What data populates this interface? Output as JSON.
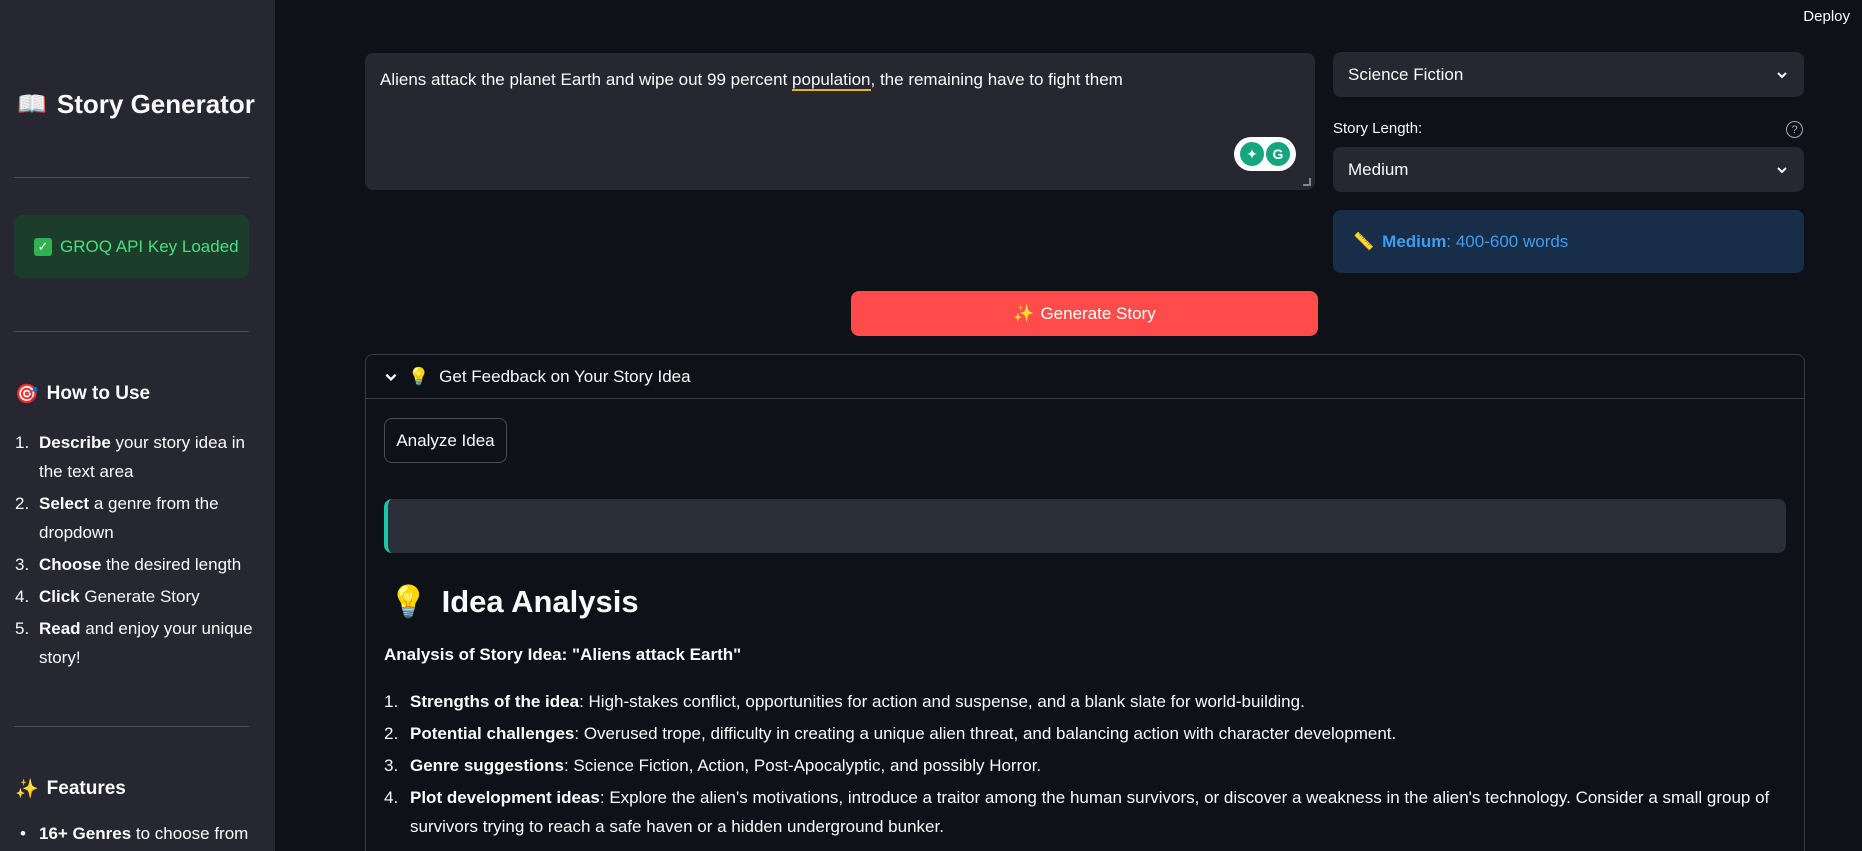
{
  "header": {
    "deploy_label": "Deploy"
  },
  "sidebar": {
    "title": "Story Generator",
    "api_status": "GROQ API Key Loaded",
    "how_to": {
      "heading": "How to Use",
      "steps": [
        {
          "num": "1.",
          "bold": "Describe",
          "text": " your story idea in the text area"
        },
        {
          "num": "2.",
          "bold": "Select",
          "text": " a genre from the dropdown"
        },
        {
          "num": "3.",
          "bold": "Choose",
          "text": " the desired length"
        },
        {
          "num": "4.",
          "bold": "Click",
          "text": " Generate Story"
        },
        {
          "num": "5.",
          "bold": "Read",
          "text": " and enjoy your unique story!"
        }
      ]
    },
    "features": {
      "heading": "Features",
      "items": [
        {
          "bold": "16+ Genres",
          "text": " to choose from"
        }
      ]
    }
  },
  "main": {
    "story_input": {
      "before": "Aliens attack the planet Earth and wipe out 99 percent ",
      "flagged": "population",
      "after": ", the remaining have to fight them"
    },
    "genre_select": {
      "value": "Science Fiction"
    },
    "length": {
      "label": "Story Length:",
      "value": "Medium",
      "info_bold": "Medium",
      "info_text": ": 400-600 words"
    },
    "generate_button": "Generate Story",
    "feedback": {
      "header": "Get Feedback on Your Story Idea",
      "analyze_button": "Analyze Idea",
      "analysis_title": "Idea Analysis",
      "analysis_subtitle": "Analysis of Story Idea: \"Aliens attack Earth\"",
      "points": [
        {
          "num": "1.",
          "bold": "Strengths of the idea",
          "text": ": High-stakes conflict, opportunities for action and suspense, and a blank slate for world-building."
        },
        {
          "num": "2.",
          "bold": "Potential challenges",
          "text": ": Overused trope, difficulty in creating a unique alien threat, and balancing action with character development."
        },
        {
          "num": "3.",
          "bold": "Genre suggestions",
          "text": ": Science Fiction, Action, Post-Apocalyptic, and possibly Horror."
        },
        {
          "num": "4.",
          "bold": "Plot development ideas",
          "text": ": Explore the alien's motivations, introduce a traitor among the human survivors, or discover a weakness in the alien's technology. Consider a small group of survivors trying to reach a safe haven or a hidden underground bunker."
        }
      ]
    }
  },
  "colors": {
    "accent": "#ff4b4b",
    "success": "#4ade80",
    "info": "#3d9df3",
    "highlight_border": "#1dc6a6"
  },
  "icons": {
    "title": "book-icon",
    "api": "check-icon",
    "how_to": "target-icon",
    "features": "sparkles-icon",
    "info": "ruler-icon",
    "generate": "sparkles-icon",
    "feedback": "lightbulb-icon"
  }
}
